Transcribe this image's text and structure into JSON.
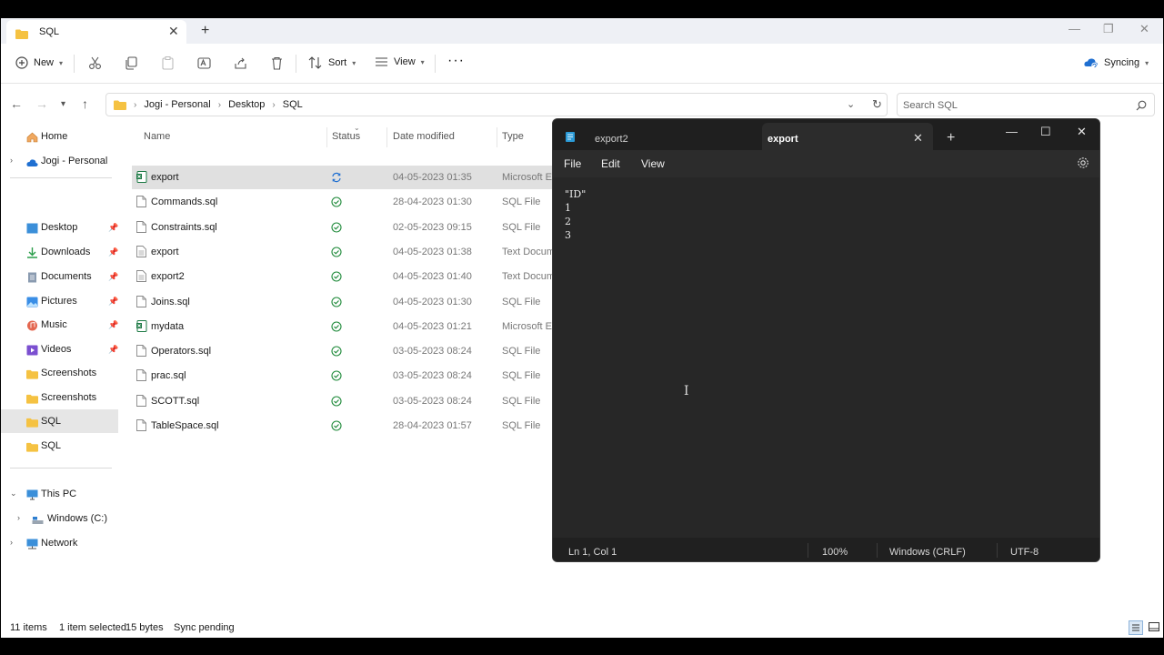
{
  "explorer": {
    "tab_title": "SQL",
    "new_tab_symbol": "+",
    "toolbar": {
      "new_label": "New",
      "sort_label": "Sort",
      "view_label": "View",
      "more_symbol": "···",
      "sync_label": "Syncing"
    },
    "breadcrumbs": [
      "Jogi - Personal",
      "Desktop",
      "SQL"
    ],
    "search_placeholder": "Search SQL",
    "sidebar": {
      "home": "Home",
      "onedrive": "Jogi - Personal",
      "pinned": [
        {
          "label": "Desktop",
          "icon": "desktop-icon"
        },
        {
          "label": "Downloads",
          "icon": "download-icon"
        },
        {
          "label": "Documents",
          "icon": "documents-icon"
        },
        {
          "label": "Pictures",
          "icon": "pictures-icon"
        },
        {
          "label": "Music",
          "icon": "music-icon"
        },
        {
          "label": "Videos",
          "icon": "videos-icon"
        }
      ],
      "folders": [
        "Screenshots",
        "Screenshots",
        "SQL",
        "SQL"
      ],
      "this_pc": "This PC",
      "drive": "Windows (C:)",
      "network": "Network"
    },
    "columns": [
      "Name",
      "Status",
      "Date modified",
      "Type"
    ],
    "files": [
      {
        "name": "export",
        "date": "04-05-2023 01:35",
        "type": "Microsoft Excel",
        "kind": "excel",
        "status": "syncing"
      },
      {
        "name": "Commands.sql",
        "date": "28-04-2023 01:30",
        "type": "SQL File",
        "kind": "file",
        "status": "ok"
      },
      {
        "name": "Constraints.sql",
        "date": "02-05-2023 09:15",
        "type": "SQL File",
        "kind": "file",
        "status": "ok"
      },
      {
        "name": "export",
        "date": "04-05-2023 01:38",
        "type": "Text Document",
        "kind": "text",
        "status": "ok"
      },
      {
        "name": "export2",
        "date": "04-05-2023 01:40",
        "type": "Text Document",
        "kind": "text",
        "status": "ok"
      },
      {
        "name": "Joins.sql",
        "date": "04-05-2023 01:30",
        "type": "SQL File",
        "kind": "file",
        "status": "ok"
      },
      {
        "name": "mydata",
        "date": "04-05-2023 01:21",
        "type": "Microsoft Excel",
        "kind": "excel",
        "status": "ok"
      },
      {
        "name": "Operators.sql",
        "date": "03-05-2023 08:24",
        "type": "SQL File",
        "kind": "file",
        "status": "ok"
      },
      {
        "name": "prac.sql",
        "date": "03-05-2023 08:24",
        "type": "SQL File",
        "kind": "file",
        "status": "ok"
      },
      {
        "name": "SCOTT.sql",
        "date": "03-05-2023 08:24",
        "type": "SQL File",
        "kind": "file",
        "status": "ok"
      },
      {
        "name": "TableSpace.sql",
        "date": "28-04-2023 01:57",
        "type": "SQL File",
        "kind": "file",
        "status": "ok"
      }
    ],
    "statusbar": {
      "items": "11 items",
      "selected": "1 item selected",
      "size": "15 bytes",
      "sync": "Sync pending"
    },
    "colors": {
      "accent": "#0067c0",
      "folder": "#f5c242",
      "ok_green": "#1f8a3a"
    }
  },
  "notepad": {
    "tabs": [
      "export2",
      "export"
    ],
    "add_tab_symbol": "+",
    "menu": [
      "File",
      "Edit",
      "View"
    ],
    "content_lines": [
      "\"ID\"",
      "1",
      "2",
      "3"
    ],
    "cursor_symbol": "I",
    "status": {
      "position": "Ln 1, Col 1",
      "zoom": "100%",
      "line_endings": "Windows (CRLF)",
      "encoding": "UTF-8"
    }
  }
}
